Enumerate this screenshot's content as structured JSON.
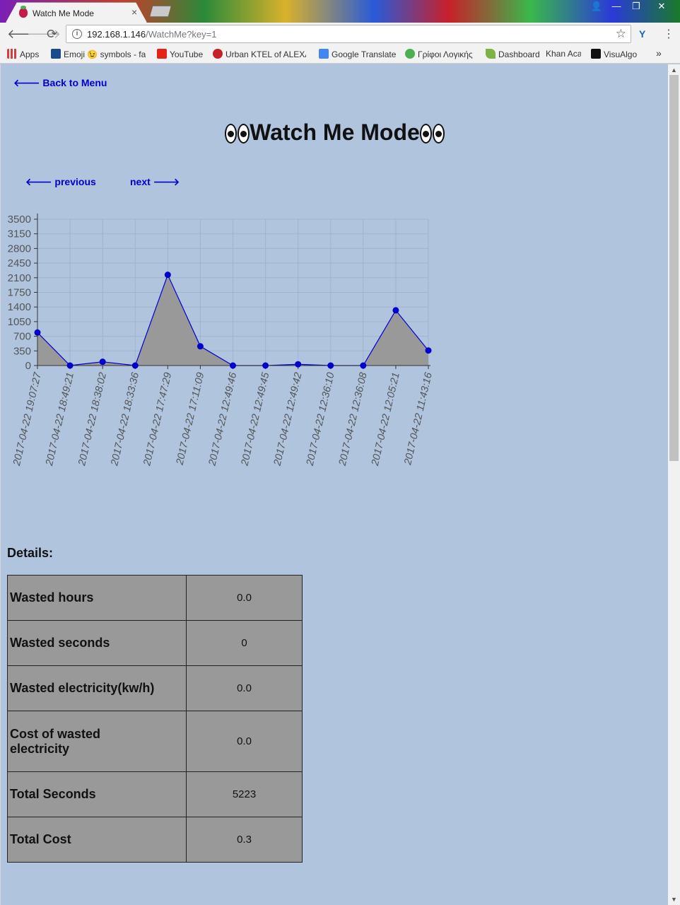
{
  "browser": {
    "tab_title": "Watch Me Mode",
    "tab_close": "×",
    "url_host": "192.168.1.146",
    "url_path": "/WatchMe?key=1",
    "bookmarks": [
      {
        "label": "Apps",
        "icon": "apps-grid-icon",
        "color": "#d04040"
      },
      {
        "label": "Emoji 😉 symbols - fa",
        "icon": "heart-icon",
        "color": "#1a4a8a"
      },
      {
        "label": "YouTube",
        "icon": "youtube-icon",
        "color": "#e62117"
      },
      {
        "label": "Urban KTEL of ALEXA",
        "icon": "ktel-icon",
        "color": "#c8202a"
      },
      {
        "label": "Google Translate",
        "icon": "translate-icon",
        "color": "#4285f4"
      },
      {
        "label": "Γρίφοι Λογικής",
        "icon": "puzzle-icon",
        "color": "#4caf50"
      },
      {
        "label": "Dashboard",
        "icon": "leaf-icon",
        "color": "#7cb342"
      },
      {
        "label": "Khan Aca",
        "icon": "khan-icon",
        "color": "#9ccc65"
      },
      {
        "label": "VisuAlgo",
        "icon": "visualgo-icon",
        "color": "#111111"
      }
    ],
    "bookmarks_more": "»"
  },
  "page": {
    "back_label": "🡐 Back to Menu",
    "title": "Watch Me Mode",
    "prev_label": "🡐 previous",
    "next_label": "next 🡒",
    "details_label": "Details:",
    "details": [
      {
        "key": "Wasted hours",
        "value": "0.0"
      },
      {
        "key": "Wasted seconds",
        "value": "0"
      },
      {
        "key": "Wasted electricity(kw/h)",
        "value": "0.0"
      },
      {
        "key": "Cost of wasted electricity",
        "value": "0.0"
      },
      {
        "key": "Total Seconds",
        "value": "5223"
      },
      {
        "key": "Total Cost",
        "value": "0.3"
      }
    ]
  },
  "chart_data": {
    "type": "area",
    "categories": [
      "2017-04-22 19:07:27",
      "2017-04-22 18:49:21",
      "2017-04-22 18:38:02",
      "2017-04-22 18:33:36",
      "2017-04-22 17:47:29",
      "2017-04-22 17:11:09",
      "2017-04-22 12:49:46",
      "2017-04-22 12:49:45",
      "2017-04-22 12:49:42",
      "2017-04-22 12:36:10",
      "2017-04-22 12:36:08",
      "2017-04-22 12:05:21",
      "2017-04-22 11:43:16"
    ],
    "values": [
      790,
      0,
      90,
      0,
      2170,
      460,
      0,
      0,
      30,
      0,
      0,
      1320,
      360
    ],
    "yticks": [
      "0",
      "350",
      "700",
      "1050",
      "1400",
      "1750",
      "2100",
      "2450",
      "2800",
      "3150",
      "3500"
    ],
    "ylim": [
      0,
      3500
    ],
    "grid": true,
    "line_color": "#0000cd",
    "fill_color": "#999999"
  }
}
